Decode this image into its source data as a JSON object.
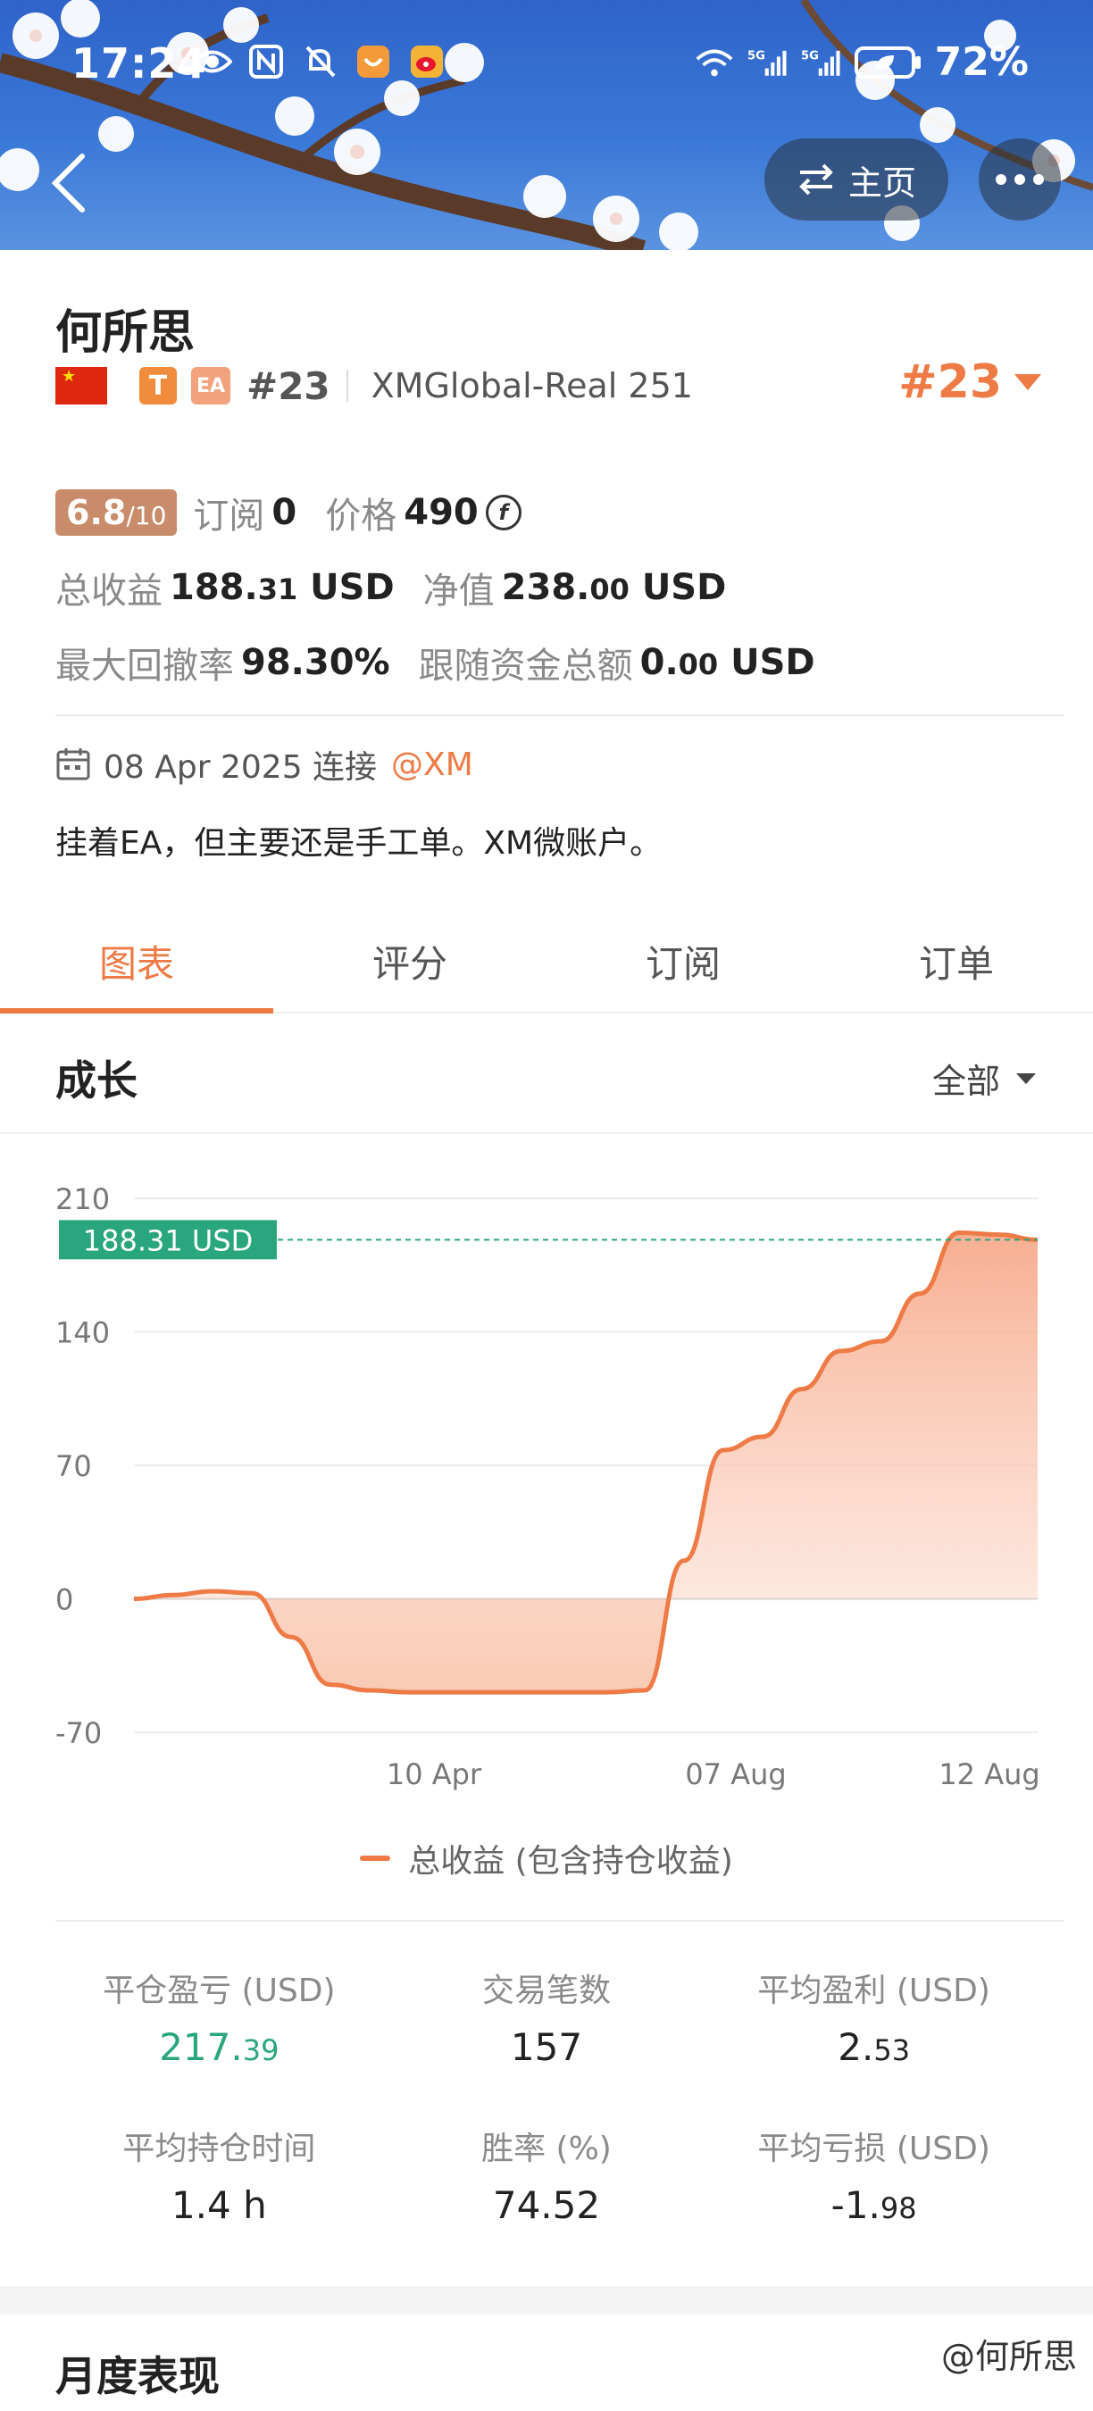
{
  "status_bar": {
    "time": "17:24",
    "battery": "72%",
    "signal_1": "5G",
    "signal_2": "5G",
    "wifi_badge": "6"
  },
  "header": {
    "home_label": "主页"
  },
  "profile": {
    "name": "何所思",
    "badge_t": "T",
    "badge_ea": "EA",
    "rank_small": "#23",
    "account": "XMGlobal-Real 251",
    "rank_big": "#23",
    "score": "6.8",
    "score_max": "/10",
    "subscribe_label": "订阅",
    "subscribe_value": "0",
    "price_label": "价格",
    "price_value": "490",
    "coin_symbol": "f",
    "total_profit_label": "总收益",
    "total_profit_int": "188.",
    "total_profit_dec": "31",
    "total_profit_unit": " USD",
    "equity_label": "净值",
    "equity_int": "238.",
    "equity_dec": "00",
    "equity_unit": " USD",
    "drawdown_label": "最大回撤率",
    "drawdown_value": "98.30%",
    "follow_label": "跟随资金总额",
    "follow_int": "0.",
    "follow_dec": "00",
    "follow_unit": " USD",
    "connect_date": "08 Apr 2025 连接",
    "connect_broker": "@XM",
    "bio": "挂着EA，但主要还是手工单。XM微账户。"
  },
  "tabs": [
    "图表",
    "评分",
    "订阅",
    "订单"
  ],
  "section": {
    "title": "成长",
    "filter": "全部"
  },
  "chart_data": {
    "type": "area",
    "series": [
      {
        "name": "总收益 (包含持仓收益)",
        "values": [
          0,
          2,
          4,
          3,
          -20,
          -45,
          -48,
          -49,
          -49,
          -49,
          -49,
          -49,
          -49,
          -48,
          20,
          78,
          85,
          110,
          130,
          135,
          160,
          192,
          191,
          188.31
        ]
      }
    ],
    "x_ticks": [
      "10 Apr",
      "07 Aug",
      "12 Aug"
    ],
    "y_ticks": [
      "210",
      "140",
      "70",
      "0",
      "-70"
    ],
    "ylim": [
      -70,
      210
    ],
    "current_label": "188.31 USD",
    "current_value": 188.31,
    "color": "#ee7a45",
    "grid": true
  },
  "legend_label": "总收益 (包含持仓收益)",
  "metrics": [
    {
      "label": "平仓盈亏 (USD)",
      "value_int": "217.",
      "value_dec": "39",
      "color": "green"
    },
    {
      "label": "交易笔数",
      "value_int": "157",
      "value_dec": "",
      "color": "default"
    },
    {
      "label": "平均盈利 (USD)",
      "value_int": "2.",
      "value_dec": "53",
      "color": "default"
    },
    {
      "label": "平均持仓时间",
      "value_int": "1.4 h",
      "value_dec": "",
      "color": "default"
    },
    {
      "label": "胜率 (%)",
      "value_int": "74.52",
      "value_dec": "",
      "color": "default"
    },
    {
      "label": "平均亏损 (USD)",
      "value_int": "-1.",
      "value_dec": "98",
      "color": "default"
    }
  ],
  "monthly_title": "月度表现",
  "watermark": "@何所思"
}
